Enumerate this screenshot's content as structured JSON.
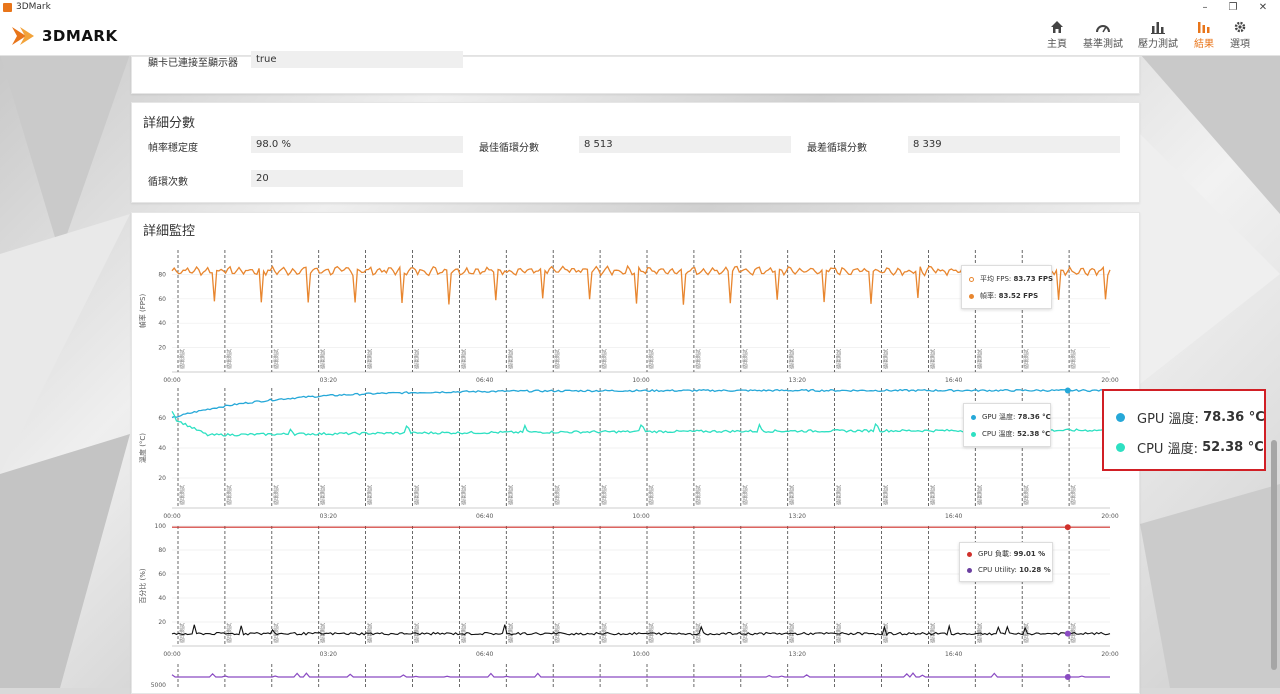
{
  "titlebar": {
    "title": "3DMark",
    "minimize": "–",
    "maximize": "❐",
    "close": "✕"
  },
  "header": {
    "logo": "3DMARK",
    "nav": [
      {
        "label": "主頁",
        "icon": "home-icon",
        "active": false
      },
      {
        "label": "基準測試",
        "icon": "gauge-icon",
        "active": false
      },
      {
        "label": "壓力測試",
        "icon": "bars-icon",
        "active": false
      },
      {
        "label": "結果",
        "icon": "results-bars-icon",
        "active": true
      },
      {
        "label": "選項",
        "icon": "gear-icon",
        "active": false
      }
    ]
  },
  "top_card": {
    "label": "顯卡已連接至顯示器",
    "value": "true"
  },
  "detail_scores": {
    "title": "詳細分數",
    "fields": [
      {
        "label": "幀率穩定度",
        "value": "98.0 %"
      },
      {
        "label": "最佳循環分數",
        "value": "8 513"
      },
      {
        "label": "最差循環分數",
        "value": "8 339"
      },
      {
        "label": "循環次數",
        "value": "20"
      }
    ]
  },
  "monitoring": {
    "title": "詳細監控",
    "marker_label": "循環測試",
    "x_ticks": [
      "00:00",
      "03:20",
      "06:40",
      "10:00",
      "13:20",
      "16:40",
      "20:00"
    ],
    "fps_ylabel": "幀率 (FPS)",
    "temp_ylabel": "溫度 (°C)",
    "pct_ylabel": "百分比 (%)",
    "fps_legend": {
      "avg_label": "平均 FPS:",
      "avg_value": "83.73 FPS",
      "fps_label": "幀率:",
      "fps_value": "83.52 FPS"
    },
    "temp_legend": {
      "gpu_label": "GPU 溫度:",
      "gpu_value": "78.36 °C",
      "cpu_label": "CPU 溫度:",
      "cpu_value": "52.38 °C"
    },
    "pct_legend": {
      "gpu_label": "GPU 負載:",
      "gpu_value": "99.01 %",
      "cpu_label": "CPU Utility:",
      "cpu_value": "10.28 %"
    },
    "bottom_tick": "5000"
  },
  "zoom_box": {
    "gpu_label": "GPU 溫度:",
    "gpu_value": "78.36 °C",
    "cpu_label": "CPU 溫度:",
    "cpu_value": "52.38 °C"
  },
  "colors": {
    "accent": "#e8751a",
    "fps": "#e8862f",
    "gpu_temp": "#26a8d8",
    "cpu_temp": "#2ee0c2",
    "gpu_load": "#d0302b",
    "cpu_util": "#111111",
    "purple": "#8a4bc2",
    "highlight": "#d11f25"
  },
  "chart_data": [
    {
      "type": "line",
      "title": "",
      "ylabel": "幀率 (FPS)",
      "ylim": [
        0,
        100
      ],
      "yticks": [
        0,
        20,
        40,
        60,
        80
      ],
      "x": [
        "00:00",
        "03:20",
        "06:40",
        "10:00",
        "13:20",
        "16:40",
        "20:00"
      ],
      "series": [
        {
          "name": "幀率",
          "values": [
            84,
            83,
            84,
            83,
            84,
            83,
            84
          ]
        },
        {
          "name": "平均 FPS",
          "values": [
            83.73
          ]
        }
      ]
    },
    {
      "type": "line",
      "title": "",
      "ylabel": "溫度 (°C)",
      "ylim": [
        0,
        80
      ],
      "yticks": [
        0,
        20,
        40,
        60
      ],
      "x": [
        "00:00",
        "03:20",
        "06:40",
        "10:00",
        "13:20",
        "16:40",
        "20:00"
      ],
      "series": [
        {
          "name": "GPU 溫度",
          "values": [
            60,
            75,
            76,
            77,
            77,
            77,
            78.36
          ]
        },
        {
          "name": "CPU 溫度",
          "values": [
            60,
            48,
            51,
            52,
            52,
            52,
            52.38
          ]
        }
      ]
    },
    {
      "type": "line",
      "title": "",
      "ylabel": "百分比 (%)",
      "ylim": [
        0,
        100
      ],
      "yticks": [
        0,
        20,
        40,
        60,
        80,
        100
      ],
      "x": [
        "00:00",
        "03:20",
        "06:40",
        "10:00",
        "13:20",
        "16:40",
        "20:00"
      ],
      "series": [
        {
          "name": "GPU 負載",
          "values": [
            99,
            99,
            99,
            99,
            99,
            99,
            99.01
          ]
        },
        {
          "name": "CPU Utility",
          "values": [
            12,
            11,
            11,
            11,
            11,
            11,
            10.28
          ]
        }
      ]
    }
  ]
}
